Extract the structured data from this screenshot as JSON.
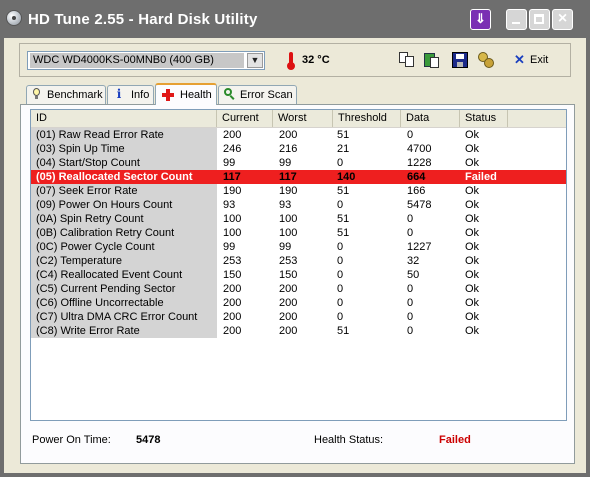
{
  "window": {
    "title": "HD Tune 2.55 - Hard Disk Utility",
    "close_glyph": "×",
    "special_glyph": "⇓"
  },
  "toolbar": {
    "drive": "WDC WD4000KS-00MNB0 (400 GB)",
    "temperature": "32 °C",
    "exit_label": "Exit",
    "icons": [
      "copy-icon",
      "copy-screenshot-icon",
      "save-icon",
      "options-icon",
      "exit-icon"
    ]
  },
  "tabs": [
    {
      "label": "Benchmark",
      "icon": "bulb-icon",
      "selected": false
    },
    {
      "label": "Info",
      "icon": "info-icon",
      "selected": false
    },
    {
      "label": "Health",
      "icon": "health-cross-icon",
      "selected": true
    },
    {
      "label": "Error Scan",
      "icon": "magnifier-icon",
      "selected": false
    }
  ],
  "table": {
    "columns": [
      "ID",
      "Current",
      "Worst",
      "Threshold",
      "Data",
      "Status"
    ],
    "rows": [
      {
        "id": "(01) Raw Read Error Rate",
        "current": "200",
        "worst": "200",
        "threshold": "51",
        "data": "0",
        "status": "Ok",
        "failed": false
      },
      {
        "id": "(03) Spin Up Time",
        "current": "246",
        "worst": "216",
        "threshold": "21",
        "data": "4700",
        "status": "Ok",
        "failed": false
      },
      {
        "id": "(04) Start/Stop Count",
        "current": "99",
        "worst": "99",
        "threshold": "0",
        "data": "1228",
        "status": "Ok",
        "failed": false
      },
      {
        "id": "(05) Reallocated Sector Count",
        "current": "117",
        "worst": "117",
        "threshold": "140",
        "data": "664",
        "status": "Failed",
        "failed": true
      },
      {
        "id": "(07) Seek Error Rate",
        "current": "190",
        "worst": "190",
        "threshold": "51",
        "data": "166",
        "status": "Ok",
        "failed": false
      },
      {
        "id": "(09) Power On Hours Count",
        "current": "93",
        "worst": "93",
        "threshold": "0",
        "data": "5478",
        "status": "Ok",
        "failed": false
      },
      {
        "id": "(0A) Spin Retry Count",
        "current": "100",
        "worst": "100",
        "threshold": "51",
        "data": "0",
        "status": "Ok",
        "failed": false
      },
      {
        "id": "(0B) Calibration Retry Count",
        "current": "100",
        "worst": "100",
        "threshold": "51",
        "data": "0",
        "status": "Ok",
        "failed": false
      },
      {
        "id": "(0C) Power Cycle Count",
        "current": "99",
        "worst": "99",
        "threshold": "0",
        "data": "1227",
        "status": "Ok",
        "failed": false
      },
      {
        "id": "(C2) Temperature",
        "current": "253",
        "worst": "253",
        "threshold": "0",
        "data": "32",
        "status": "Ok",
        "failed": false
      },
      {
        "id": "(C4) Reallocated Event Count",
        "current": "150",
        "worst": "150",
        "threshold": "0",
        "data": "50",
        "status": "Ok",
        "failed": false
      },
      {
        "id": "(C5) Current Pending Sector",
        "current": "200",
        "worst": "200",
        "threshold": "0",
        "data": "0",
        "status": "Ok",
        "failed": false
      },
      {
        "id": "(C6) Offline Uncorrectable",
        "current": "200",
        "worst": "200",
        "threshold": "0",
        "data": "0",
        "status": "Ok",
        "failed": false
      },
      {
        "id": "(C7) Ultra DMA CRC Error Count",
        "current": "200",
        "worst": "200",
        "threshold": "0",
        "data": "0",
        "status": "Ok",
        "failed": false
      },
      {
        "id": "(C8) Write Error Rate",
        "current": "200",
        "worst": "200",
        "threshold": "51",
        "data": "0",
        "status": "Ok",
        "failed": false
      }
    ]
  },
  "status_bar": {
    "power_on_label": "Power On Time:",
    "power_on_value": "5478",
    "health_label": "Health Status:",
    "health_value": "Failed"
  },
  "colors": {
    "failed_row": "#ee1f1f",
    "failed_text": "#cc0000",
    "titlebar": "#6e6e6e"
  }
}
